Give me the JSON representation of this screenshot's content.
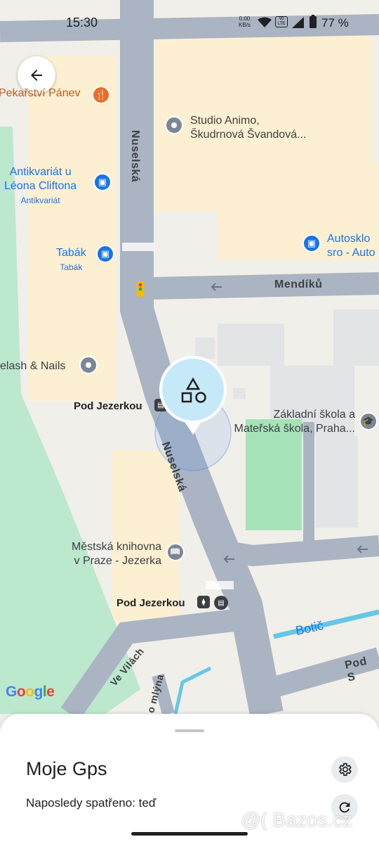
{
  "status_bar": {
    "time": "15:30",
    "net_speed_value": "0.00",
    "net_speed_unit": "KB/s",
    "battery_percent": "77 %"
  },
  "map": {
    "pois": {
      "pekarstvi": "Pekařství Pánev",
      "studio": "Studio Animo,",
      "studio_line2": "Škudrnová Švandová...",
      "antikvariat": "Antikvariát u",
      "antikvariat_line2": "Léona Cliftona",
      "antikvariat_sub": "Antikvariát",
      "tabak": "Tabák",
      "tabak_sub": "Tabák",
      "autosklo": "Autosklo",
      "autosklo_line2": "sro - Auto",
      "lash": "elash & Nails",
      "skola": "Základní škola a",
      "skola_line2": "Mateřská škola, Praha...",
      "knihovna": "Městská knihovna",
      "knihovna_line2": "v Praze - Jezerka"
    },
    "stops": {
      "stop1": "Pod Jezerkou",
      "stop2": "Pod Jezerkou"
    },
    "roads": {
      "nuselska_1": "Nuselská",
      "nuselska_2": "Nuselská",
      "mendiku": "Mendíků",
      "ve_vilach": "Ve Vilách",
      "mlyna": "o mlýna",
      "pod_s": "Pod S"
    },
    "water": "Botič",
    "google": [
      "G",
      "o",
      "o",
      "g",
      "l",
      "e"
    ],
    "colors": {
      "road": "#aab4c3",
      "park": "#bce8ce",
      "poi_blue": "#1a73e8",
      "poi_orange": "#ee6c22",
      "poi_gray": "#7b8794",
      "water": "#64c8e6",
      "marker": "#c6e9fa"
    }
  },
  "marker": {
    "icon": "shapes-icon"
  },
  "sheet": {
    "title": "Moje Gps",
    "status": "Naposledy spatřeno: teď"
  },
  "watermark": "@( Bazos.cz"
}
